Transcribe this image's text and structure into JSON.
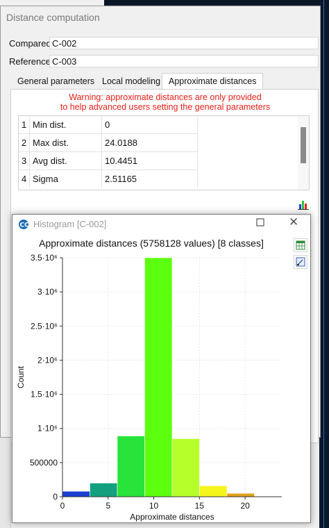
{
  "dialog": {
    "title": "Distance computation",
    "compared_label": "Compared",
    "compared_value": "C-002",
    "reference_label": "Reference",
    "reference_value": "C-003",
    "tabs": [
      "General parameters",
      "Local modeling",
      "Approximate distances"
    ],
    "active_tab": "Approximate distances",
    "warning_line1": "Warning: approximate distances are only provided",
    "warning_line2": "to help advanced users setting the general parameters",
    "stats": [
      {
        "index": "1",
        "name": "Min dist.",
        "value": "0"
      },
      {
        "index": "2",
        "name": "Max dist.",
        "value": "24.0188"
      },
      {
        "index": "3",
        "name": "Avg dist.",
        "value": "10.4451"
      },
      {
        "index": "4",
        "name": "Sigma",
        "value": "2.51165"
      }
    ],
    "histogram_button_icon": "histogram-icon"
  },
  "histogram_window": {
    "title": "Histogram [C-002]",
    "app_icon": "cloudcompare-icon",
    "export_icon": "export-csv-icon",
    "export_image_icon": "export-image-icon"
  },
  "chart_data": {
    "type": "bar",
    "title": "Approximate distances (5758128 values) [8 classes]",
    "xlabel": "Approximate distances",
    "ylabel": "Count",
    "xlim": [
      0,
      24.0188
    ],
    "ylim": [
      0,
      3500000
    ],
    "x_ticks": [
      0,
      5,
      10,
      15,
      20
    ],
    "y_ticks": [
      {
        "value": 0,
        "label": "0"
      },
      {
        "value": 500000,
        "label": "500000"
      },
      {
        "value": 1000000,
        "label": "1·10⁶"
      },
      {
        "value": 1500000,
        "label": "1.5·10⁶"
      },
      {
        "value": 2000000,
        "label": "2·10⁶"
      },
      {
        "value": 2500000,
        "label": "2.5·10⁶"
      },
      {
        "value": 3000000,
        "label": "3·10⁶"
      },
      {
        "value": 3500000,
        "label": "3.5·10⁶"
      }
    ],
    "bins": [
      {
        "start": 0,
        "end": 3.002,
        "value": 80000,
        "color": "#1a3fd1"
      },
      {
        "start": 3.002,
        "end": 6.005,
        "value": 200000,
        "color": "#12a07e"
      },
      {
        "start": 6.005,
        "end": 9.007,
        "value": 890000,
        "color": "#27e33a"
      },
      {
        "start": 9.007,
        "end": 12.009,
        "value": 3500000,
        "color": "#5cff0d"
      },
      {
        "start": 12.009,
        "end": 15.012,
        "value": 850000,
        "color": "#b6ff2a"
      },
      {
        "start": 15.012,
        "end": 18.014,
        "value": 160000,
        "color": "#f5f51a"
      },
      {
        "start": 18.014,
        "end": 21.016,
        "value": 50000,
        "color": "#e0a01a"
      },
      {
        "start": 21.016,
        "end": 24.019,
        "value": 0,
        "color": "#e04a1a"
      }
    ]
  }
}
